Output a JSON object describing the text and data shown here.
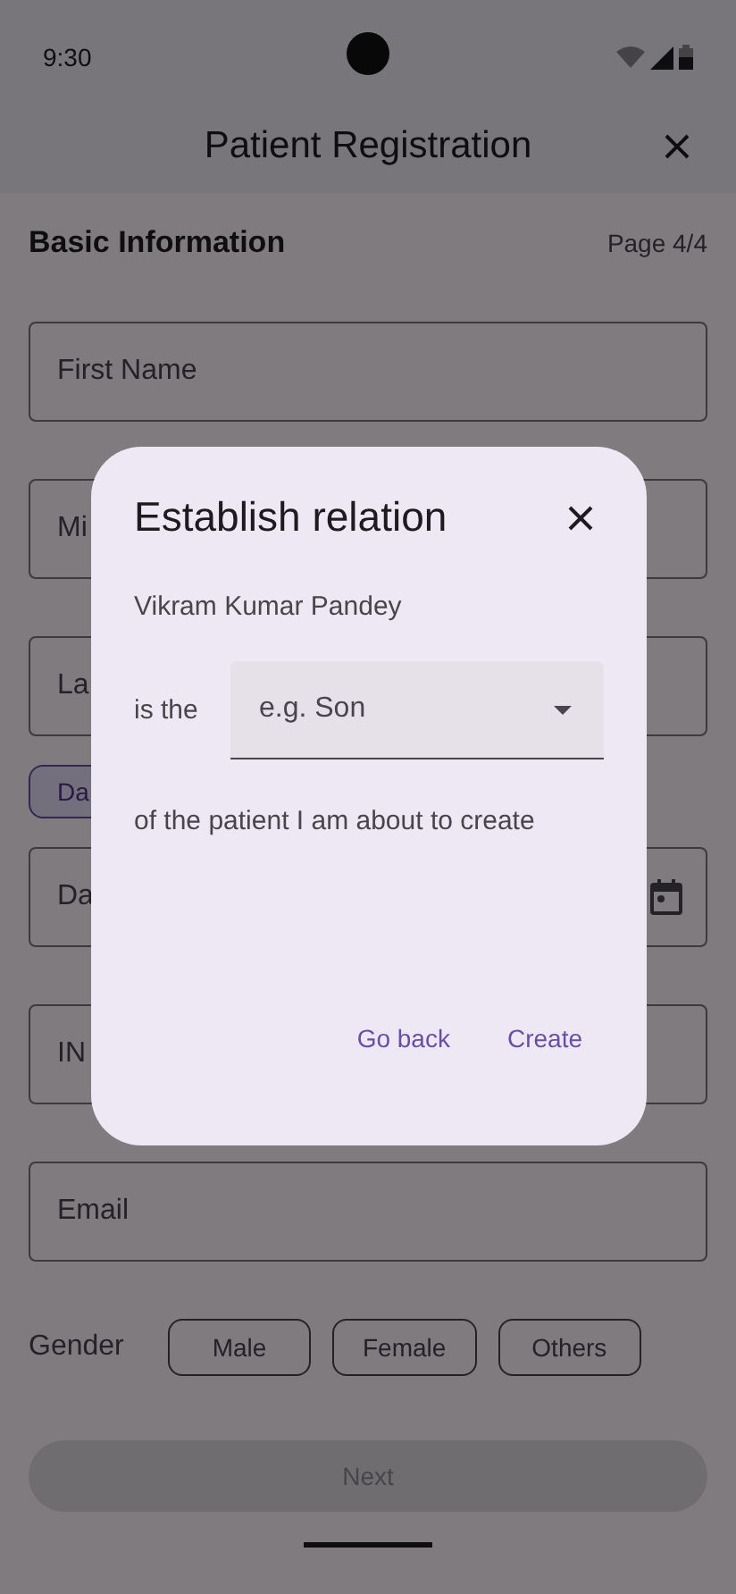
{
  "status_bar": {
    "time": "9:30"
  },
  "app_bar": {
    "title": "Patient Registration"
  },
  "section": {
    "title": "Basic Information",
    "page": "Page 4/4"
  },
  "fields": [
    {
      "kind": "text",
      "placeholder": "First Name"
    },
    {
      "kind": "text",
      "placeholder": "Mi"
    },
    {
      "kind": "text",
      "placeholder": "La"
    },
    {
      "kind": "chip",
      "label": "Da"
    },
    {
      "kind": "date",
      "placeholder": "Da"
    },
    {
      "kind": "text",
      "placeholder": "IN"
    },
    {
      "kind": "text",
      "placeholder": "Email"
    }
  ],
  "gender": {
    "label": "Gender",
    "options": [
      {
        "label": "Male",
        "selected": false
      },
      {
        "label": "Female",
        "selected": false
      },
      {
        "label": "Others",
        "selected": false
      }
    ]
  },
  "next_button": {
    "label": "Next",
    "disabled": true
  },
  "dialog": {
    "title": "Establish relation",
    "name": "Vikram Kumar Pandey",
    "prefix": "is the",
    "relation": {
      "placeholder": "e.g. Son"
    },
    "suffix": "of the patient I am about to create",
    "actions": [
      {
        "label": "Go back"
      },
      {
        "label": "Create"
      }
    ]
  }
}
